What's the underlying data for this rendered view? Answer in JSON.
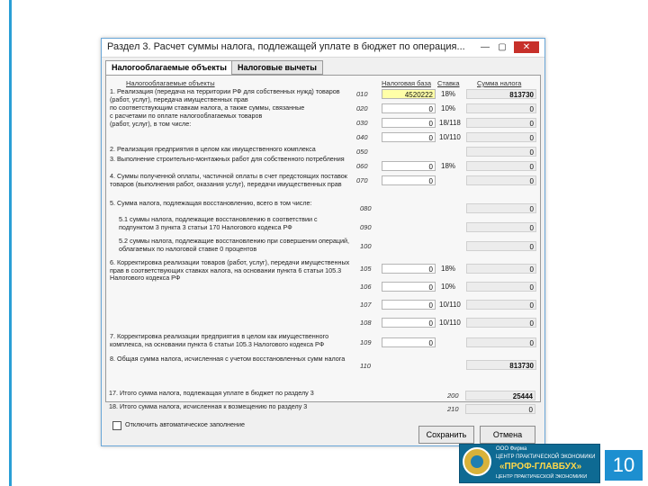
{
  "window": {
    "title": "Раздел 3. Расчет суммы налога, подлежащей уплате в бюджет по операция...",
    "min": "—",
    "max": "▢",
    "close": "✕"
  },
  "tabs": [
    {
      "label": "Налогооблагаемые объекты"
    },
    {
      "label": "Налоговые вычеты"
    }
  ],
  "headers": {
    "section": "Налогооблагаемые объекты",
    "base": "Налоговая база",
    "rate": "Ставка",
    "tax": "Сумма налога"
  },
  "rows": [
    {
      "label": "1. Реализация (передача на территории РФ для собственных нужд) товаров (работ, услуг), передача имущественных прав",
      "code": "010",
      "base": "4520222",
      "rate": "18%",
      "tax": "813730"
    },
    {
      "label": "по соответствующим ставкам налога, а также суммы, связанные",
      "code": "020",
      "base": "0",
      "rate": "10%",
      "tax": "0"
    },
    {
      "label": "с расчетами по оплате налогооблагаемых товаров",
      "code": "030",
      "base": "0",
      "rate": "18/118",
      "tax": "0"
    },
    {
      "label": "(работ, услуг), в том числе:",
      "code": "040",
      "base": "0",
      "rate": "10/110",
      "tax": "0"
    },
    {
      "label": "2. Реализация предприятия в целом как имущественного комплекса",
      "code": "050",
      "base": "",
      "rate": "",
      "tax": "0"
    },
    {
      "label": "3. Выполнение строительно-монтажных работ для собственного потребления",
      "code": "060",
      "base": "0",
      "rate": "18%",
      "tax": "0"
    },
    {
      "label": "4. Суммы полученной оплаты, частичной оплаты в счет предстоящих поставок товаров (выполнения работ, оказания услуг), передачи имущественных прав",
      "code": "070",
      "base": "0",
      "rate": "",
      "tax": "0"
    },
    {
      "label": "5. Сумма налога, подлежащая восстановлению, всего в том числе:",
      "code": "080",
      "base": "",
      "rate": "",
      "tax": "0"
    },
    {
      "label": "5.1 суммы налога, подлежащие восстановлению в соответствии с подпунктом 3 пункта 3 статьи 170 Налогового кодекса РФ",
      "code": "090",
      "base": "",
      "rate": "",
      "tax": "0"
    },
    {
      "label": "5.2 суммы налога, подлежащие восстановлению при совершении операций, облагаемых по налоговой ставке 0 процентов",
      "code": "100",
      "base": "",
      "rate": "",
      "tax": "0"
    },
    {
      "label": "6. Корректировка реализации товаров (работ, услуг), передачи имущественных прав в соответствующих ставках налога, на основании пункта 6 статьи 105.3 Налогового кодекса РФ",
      "code": "105",
      "base": "0",
      "rate": "18%",
      "tax": "0"
    },
    {
      "label": "",
      "code": "106",
      "base": "0",
      "rate": "10%",
      "tax": "0"
    },
    {
      "label": "",
      "code": "107",
      "base": "0",
      "rate": "10/110",
      "tax": "0"
    },
    {
      "label": "",
      "code": "108",
      "base": "0",
      "rate": "10/110",
      "tax": "0"
    },
    {
      "label": "7. Корректировка реализации предприятия в целом как имущественного комплекса, на основании пункта 6 статьи 105.3 Налогового кодекса РФ",
      "code": "109",
      "base": "0",
      "rate": "",
      "tax": "0"
    },
    {
      "label": "8. Общая сумма налога, исчисленная с учетом восстановленных сумм налога",
      "code": "110",
      "base": "",
      "rate": "",
      "tax": "813730"
    }
  ],
  "totals": [
    {
      "label": "17. Итого сумма налога, подлежащая уплате в бюджет по разделу 3",
      "code": "200",
      "value": "25444"
    },
    {
      "label": "18. Итого сумма налога, исчисленная к возмещению по разделу 3",
      "code": "210",
      "value": "0"
    }
  ],
  "auto_fill_label": "Отключить автоматическое заполнение",
  "save_button": "Сохранить",
  "cancel_button": "Отмена",
  "logo": {
    "line1": "ООО Фирма",
    "line2": "ЦЕНТР ПРАКТИЧЕСКОЙ ЭКОНОМИКИ",
    "brand": "«ПРОФ-ГЛАВБУХ»",
    "line4": "ЦЕНТР ПРАКТИЧЕСКОЙ ЭКОНОМИКИ"
  },
  "page_number": "10"
}
